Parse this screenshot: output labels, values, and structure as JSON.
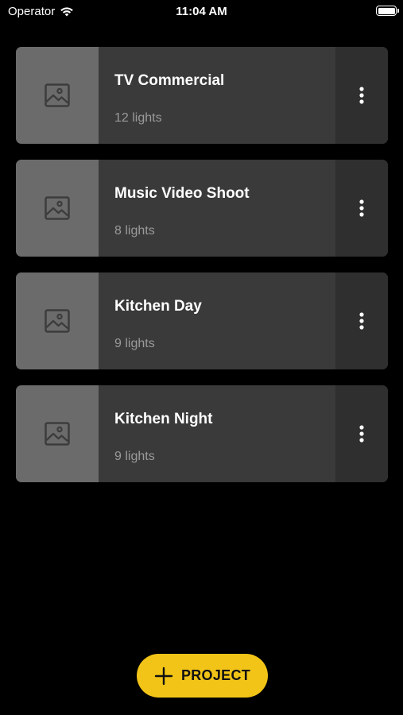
{
  "status_bar": {
    "carrier": "Operator",
    "time": "11:04 AM"
  },
  "projects": [
    {
      "title": "TV Commercial",
      "subtitle": "12 lights"
    },
    {
      "title": "Music Video Shoot",
      "subtitle": "8 lights"
    },
    {
      "title": "Kitchen Day",
      "subtitle": "9 lights"
    },
    {
      "title": "Kitchen Night",
      "subtitle": "9 lights"
    }
  ],
  "add_button": {
    "label": "PROJECT",
    "icon": "plus-icon"
  },
  "colors": {
    "background": "#000000",
    "card": "#3a3a3a",
    "thumb": "#6b6b6b",
    "menu": "#2f2f2f",
    "accent": "#f2c417"
  }
}
